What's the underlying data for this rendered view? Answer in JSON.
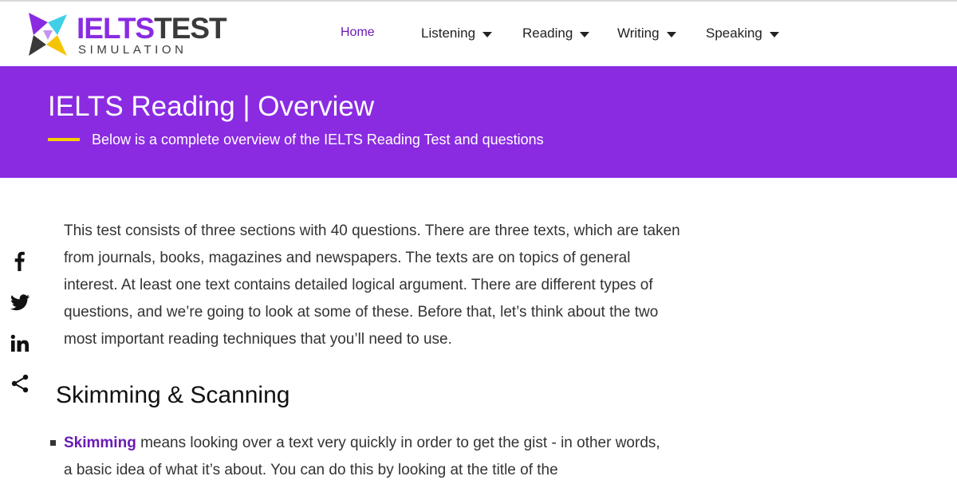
{
  "brand": {
    "word_part1": "IELTS",
    "word_part2": "TEST",
    "subtitle": "SIMULATION",
    "colors": {
      "purple": "#8a2be2",
      "dark": "#3a3a3a",
      "yellow": "#f5d000"
    }
  },
  "nav": {
    "home": "Home",
    "listening": "Listening",
    "reading": "Reading",
    "writing": "Writing",
    "speaking": "Speaking"
  },
  "banner": {
    "title": "IELTS Reading | Overview",
    "subtitle": "Below is a complete overview of the IELTS Reading Test and questions",
    "background": "#8a2be2",
    "accent": "#f5d000"
  },
  "social": {
    "icons": [
      "facebook-icon",
      "twitter-icon",
      "linkedin-icon",
      "share-icon"
    ]
  },
  "content": {
    "intro": "This test consists of three sections with 40 questions. There are three texts, which are taken from journals, books, magazines and newspapers. The texts are on topics of general interest. At least one text contains detailed logical argument. There are different types of questions, and we’re going to look at some of these. Before that, let’s think about the two most important reading techniques that you’ll need to use.",
    "heading": "Skimming & Scanning",
    "skimming_keyword": "Skimming",
    "skimming_text": " means looking over a text very quickly in order to get the gist - in other words, a basic idea of what it’s about. You can do this by looking at the title of the"
  }
}
